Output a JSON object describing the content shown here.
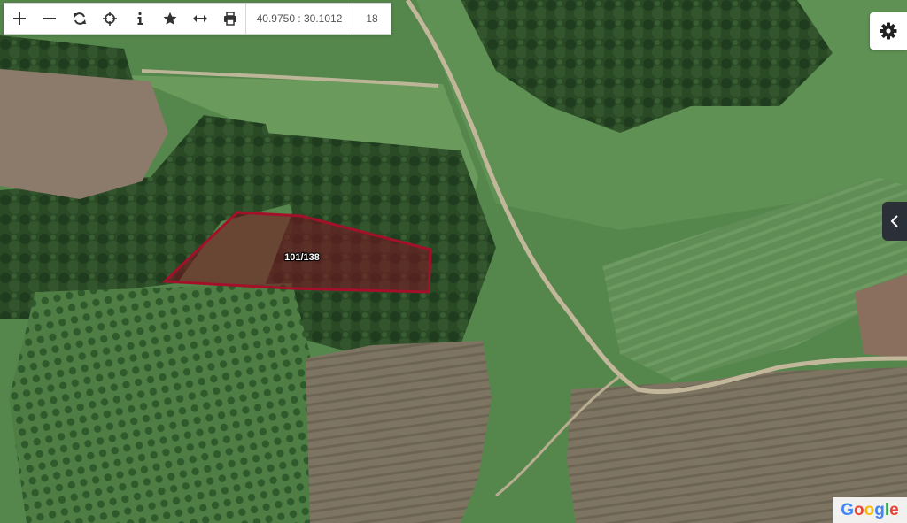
{
  "toolbar": {
    "buttons": [
      {
        "name": "zoom-in-button",
        "icon": "plus-icon"
      },
      {
        "name": "zoom-out-button",
        "icon": "minus-icon"
      },
      {
        "name": "refresh-button",
        "icon": "refresh-icon"
      },
      {
        "name": "locate-button",
        "icon": "crosshair-icon"
      },
      {
        "name": "info-button",
        "icon": "info-icon"
      },
      {
        "name": "favorite-button",
        "icon": "star-icon"
      },
      {
        "name": "measure-button",
        "icon": "double-arrow-icon"
      },
      {
        "name": "print-button",
        "icon": "printer-icon"
      }
    ],
    "coordinates": "40.9750 : 30.1012",
    "zoom_level": "18"
  },
  "parcel": {
    "label": "101/138",
    "stroke_color": "#a3102a",
    "fill_color": "#7a1020"
  },
  "settings": {
    "icon": "gear-icon"
  },
  "side_panel": {
    "icon": "chevron-left-icon"
  },
  "attribution": {
    "logo_text": "Google",
    "letters": [
      {
        "ch": "G",
        "color": "#4285f4"
      },
      {
        "ch": "o",
        "color": "#ea4335"
      },
      {
        "ch": "o",
        "color": "#fbbc05"
      },
      {
        "ch": "g",
        "color": "#4285f4"
      },
      {
        "ch": "l",
        "color": "#34a853"
      },
      {
        "ch": "e",
        "color": "#ea4335"
      }
    ]
  }
}
